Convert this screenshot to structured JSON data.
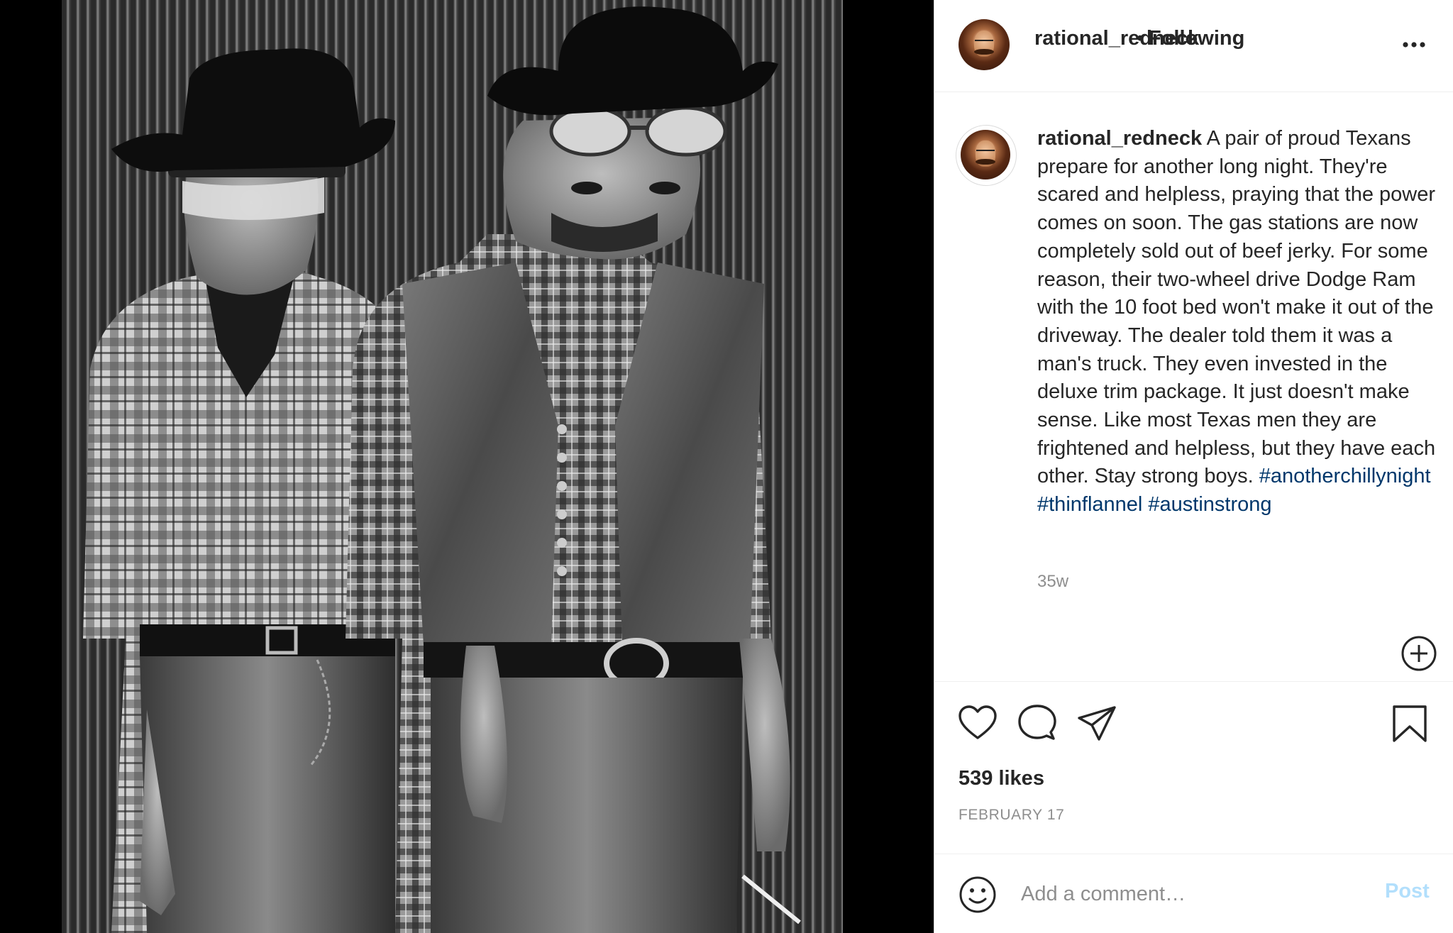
{
  "header": {
    "username": "rational_redneck",
    "separator": "•",
    "follow_status": "Following",
    "more_icon": "more-horizontal-icon"
  },
  "caption": {
    "username": "rational_redneck",
    "text": " A pair of proud Texans prepare for another long night. They're scared and helpless, praying that the power comes on soon. The gas stations are now completely sold out of beef jerky. For some reason, their two-wheel drive Dodge Ram with the 10 foot bed won't make it out of the driveway. The dealer told them it was a man's truck. They even invested in the deluxe trim package. It just doesn't make sense. Like most Texas men they are frightened and helpless, but they have each other. Stay strong boys. ",
    "hashtags": [
      "#anotherchillynight",
      "#thinflannel",
      "#austinstrong"
    ],
    "age": "35w"
  },
  "actions": {
    "icons": [
      "heart-icon",
      "comment-icon",
      "share-icon",
      "bookmark-icon"
    ],
    "likes": "539 likes",
    "date": "FEBRUARY 17"
  },
  "comment_box": {
    "placeholder": "Add a comment…",
    "post_label": "Post"
  },
  "colors": {
    "text": "#262626",
    "muted": "#8e8e8e",
    "hashtag": "#00376b",
    "post_disabled": "#b2dffc",
    "border": "#dbdbdb"
  }
}
